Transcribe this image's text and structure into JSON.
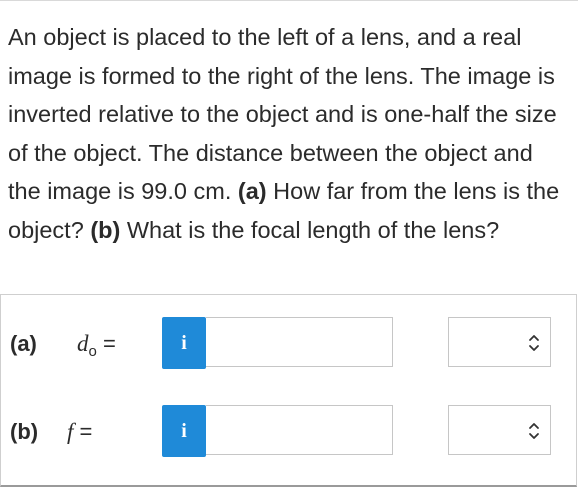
{
  "problem": {
    "statement": "An object is placed to the left of a lens, and a real image is formed to the right of the lens. The image is inverted relative to the object and is one-half the size of the object. The distance between the object and the image is 99.0 cm.",
    "part_a_marker": "(a)",
    "part_a_question": "How far from the lens is the object?",
    "part_b_marker": "(b)",
    "part_b_question": "What is the focal length of the lens?"
  },
  "answers": {
    "a": {
      "label": "(a)",
      "variable": "d",
      "subscript": "o",
      "equals": " =",
      "info_glyph": "i",
      "value": "",
      "unit": ""
    },
    "b": {
      "label": "(b)",
      "variable": "f",
      "equals": " =",
      "info_glyph": "i",
      "value": "",
      "unit": ""
    }
  },
  "colors": {
    "info_button": "#1f8ad8",
    "text": "#2b2b2b",
    "border": "#c6c6c6"
  },
  "icons": {
    "info": "info-icon",
    "unit_toggle": "chevron-up-down-icon"
  }
}
